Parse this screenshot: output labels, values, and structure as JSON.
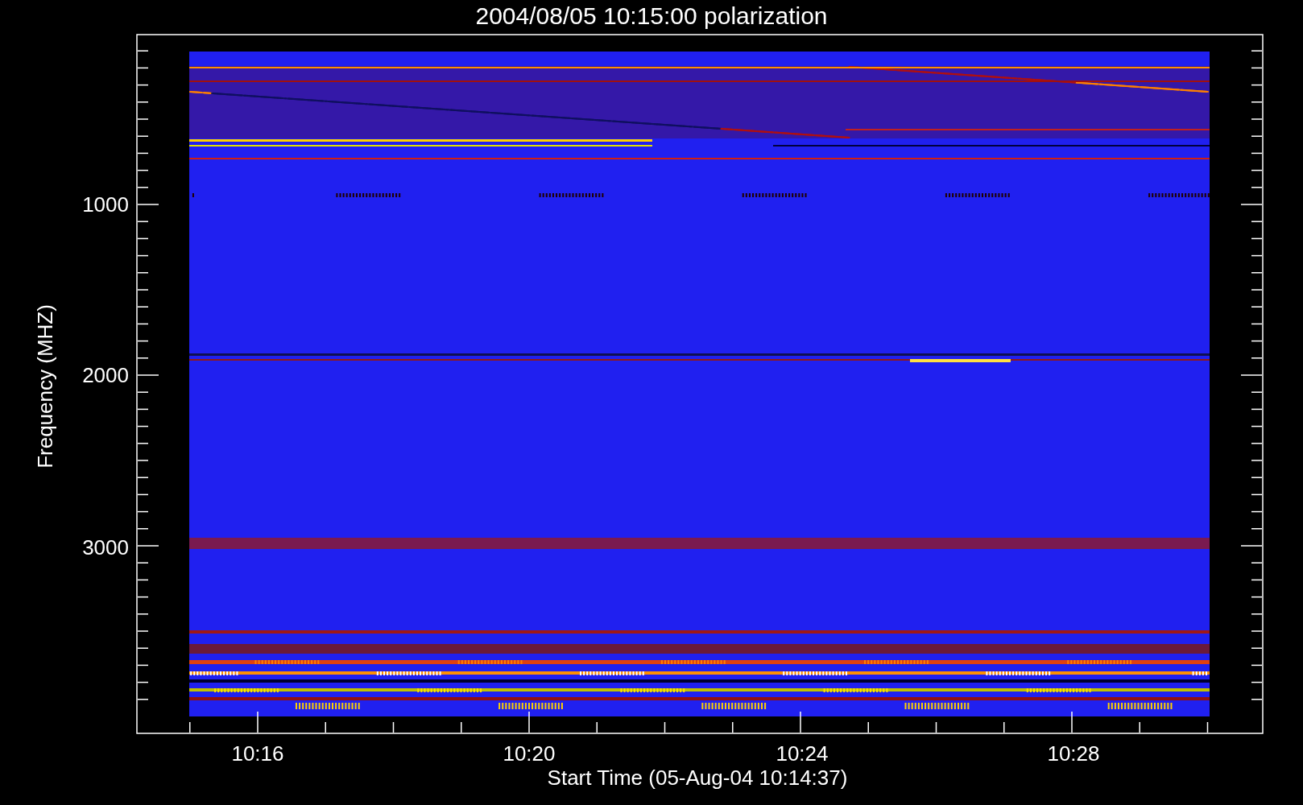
{
  "title": "2004/08/05 10:15:00 polarization",
  "y_axis": {
    "label": "Frequency (MHZ)",
    "tick_labels": [
      "1000",
      "2000",
      "3000"
    ]
  },
  "x_axis": {
    "label": "Start Time (05-Aug-04 10:14:37)",
    "tick_labels": [
      "10:16",
      "10:20",
      "10:24",
      "10:28"
    ]
  }
}
